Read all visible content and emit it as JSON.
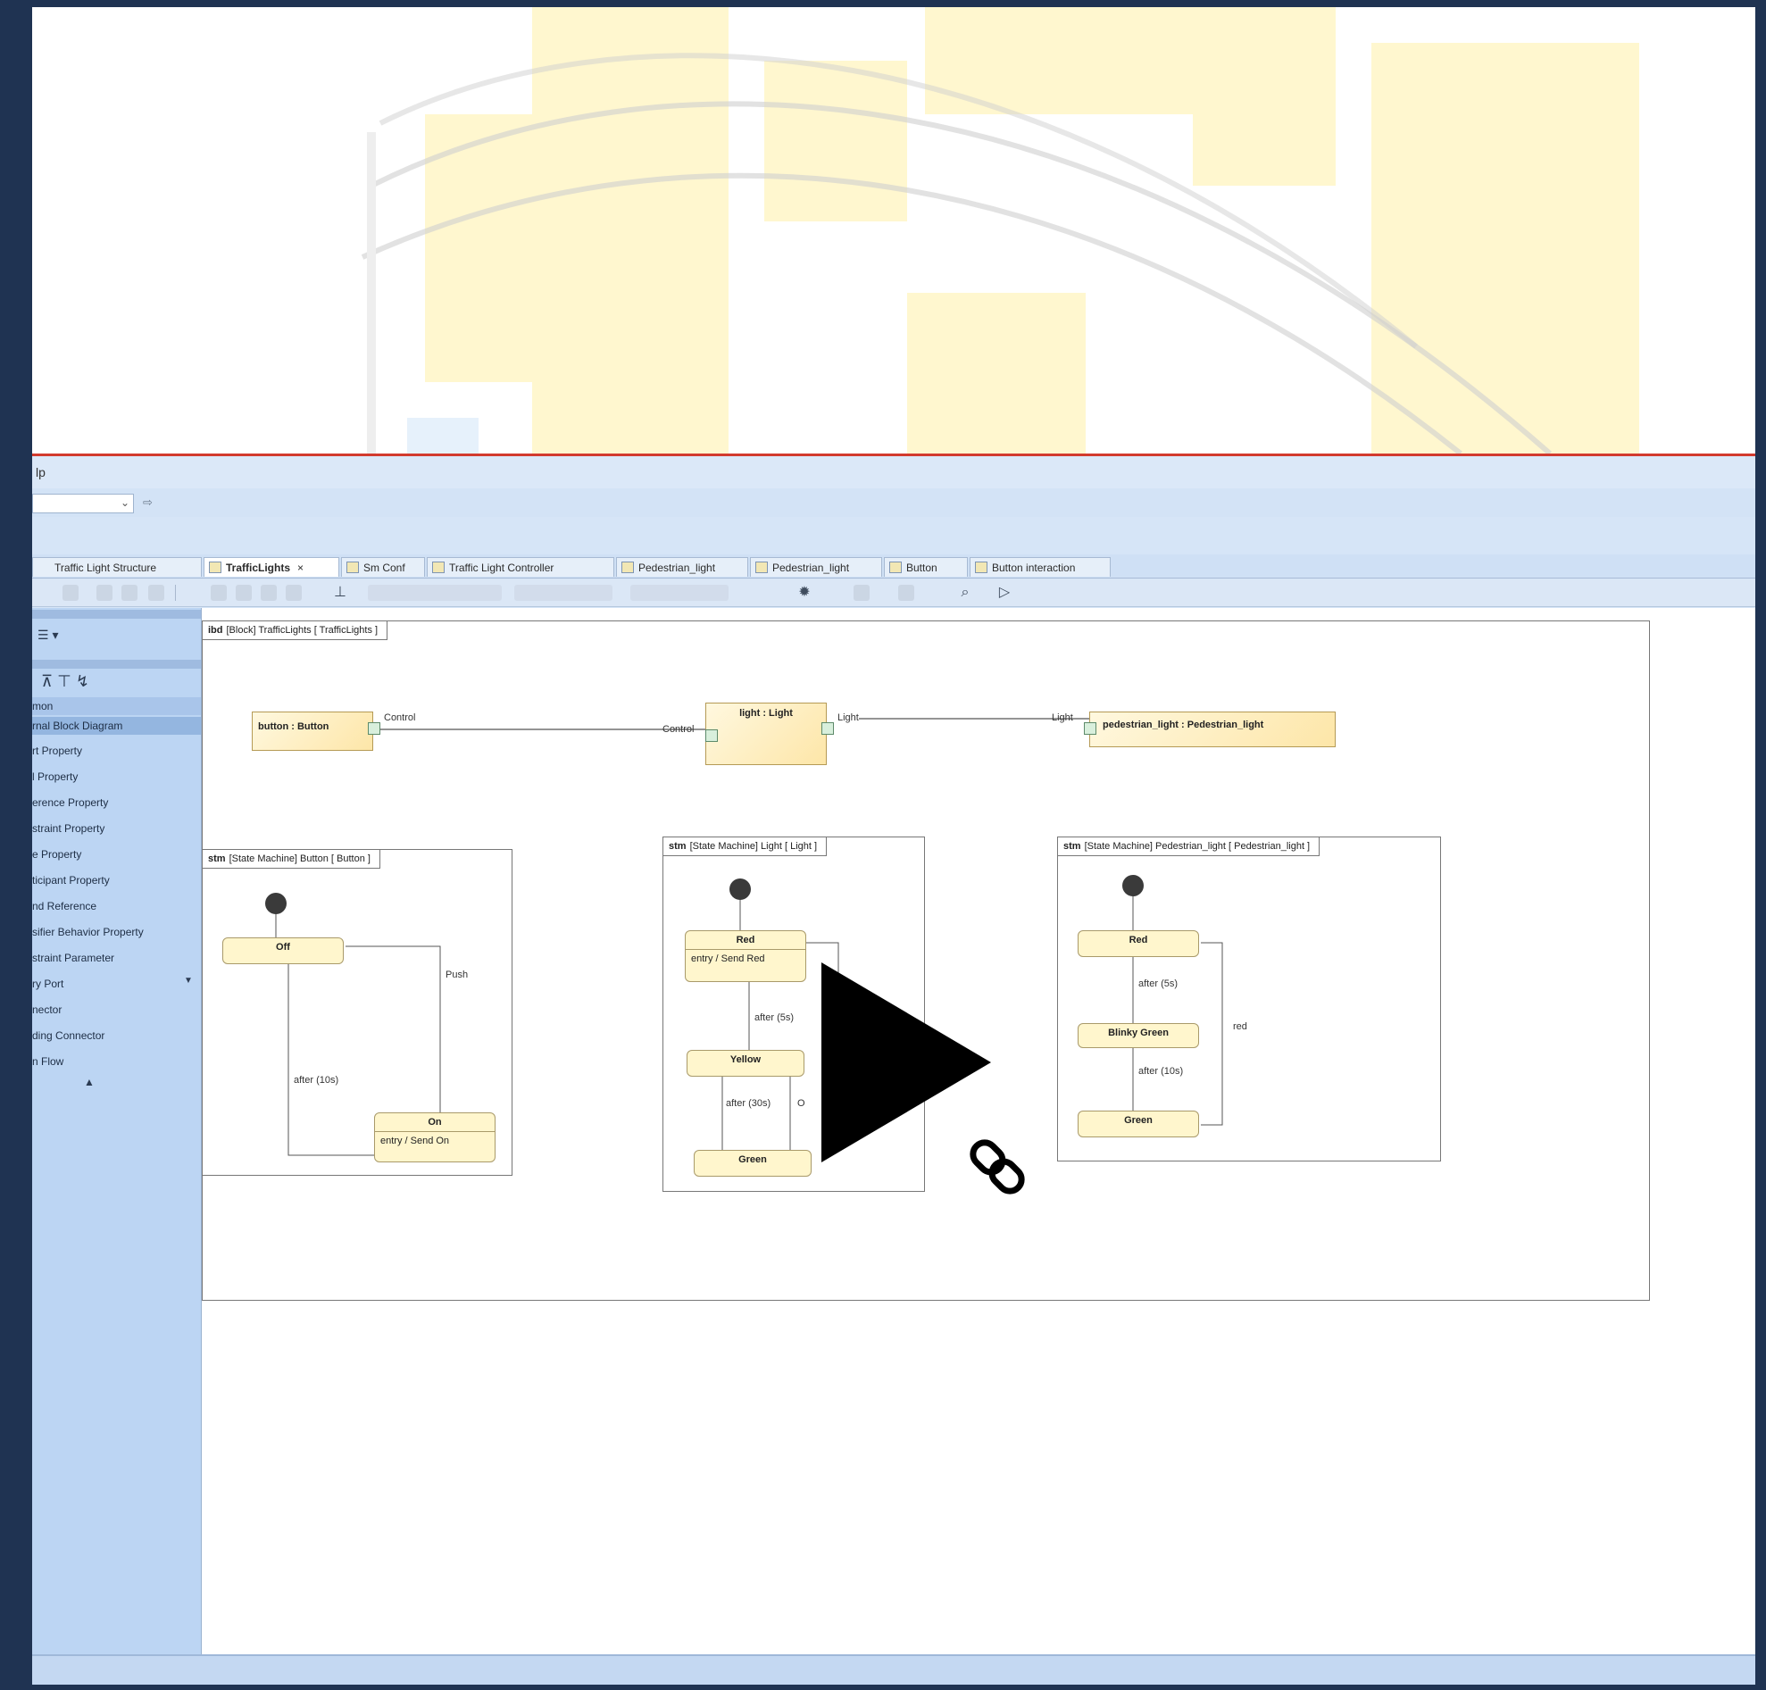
{
  "menubar": {
    "help_fragment": "lp"
  },
  "tabs": [
    {
      "label": "Traffic Light Structure"
    },
    {
      "label": "TrafficLights",
      "close": "×"
    },
    {
      "label": "Sm Conf"
    },
    {
      "label": "Traffic Light Controller"
    },
    {
      "label": "Pedestrian_light"
    },
    {
      "label": "Pedestrian_light"
    },
    {
      "label": "Button"
    },
    {
      "label": "Button interaction"
    }
  ],
  "palette": {
    "categories": [
      "mon",
      "rnal Block Diagram"
    ],
    "items": [
      "rt Property",
      "l Property",
      "erence Property",
      "straint Property",
      "e Property",
      "ticipant Property",
      "nd Reference",
      "sifier Behavior Property",
      "straint Parameter",
      "ry Port",
      "nector",
      "ding Connector",
      "n Flow"
    ]
  },
  "ibd": {
    "header": "ibd [Block] TrafficLights [ TrafficLights ]",
    "kind": "ibd",
    "rest": "[Block] TrafficLights [ TrafficLights ]",
    "blocks": {
      "button": "button : Button",
      "light": "light : Light",
      "pedestrian": "pedestrian_light : Pedestrian_light"
    },
    "ports": {
      "control_out": "Control",
      "control_in": "Control",
      "light_out": "Light",
      "light_in": "Light"
    }
  },
  "stm_button": {
    "kind": "stm",
    "header": "[State Machine] Button [",
    "header_end": "Button ]",
    "states": {
      "off": "Off",
      "on": "On",
      "on_entry": "entry / Send On"
    },
    "transitions": {
      "push": "Push",
      "after": "after (10s)"
    }
  },
  "stm_light": {
    "kind": "stm",
    "header": "[State Machine] Light [",
    "header_end": "Light ]",
    "states": {
      "red": "Red",
      "red_entry": "entry / Send Red",
      "yellow": "Yellow",
      "green": "Green"
    },
    "transitions": {
      "after5": "after (5s)",
      "after30": "after (30s)",
      "o": "O"
    }
  },
  "stm_ped": {
    "kind": "stm",
    "header": "[State Machine] Pedestrian_light [",
    "header_end": "Pedestrian_light ]",
    "states": {
      "red": "Red",
      "blinky": "Blinky Green",
      "green": "Green"
    },
    "transitions": {
      "after5": "after (5s)",
      "after10": "after (10s)",
      "red": "red"
    }
  },
  "colors": {
    "frame": "#1f3352",
    "accent_red": "#d23a2e",
    "palette_bg": "#bcd5f3",
    "block_fill": "#fde6a8",
    "state_fill": "#fff6cd"
  },
  "icons": [
    "play-icon",
    "link-icon",
    "chevron-down-icon"
  ]
}
